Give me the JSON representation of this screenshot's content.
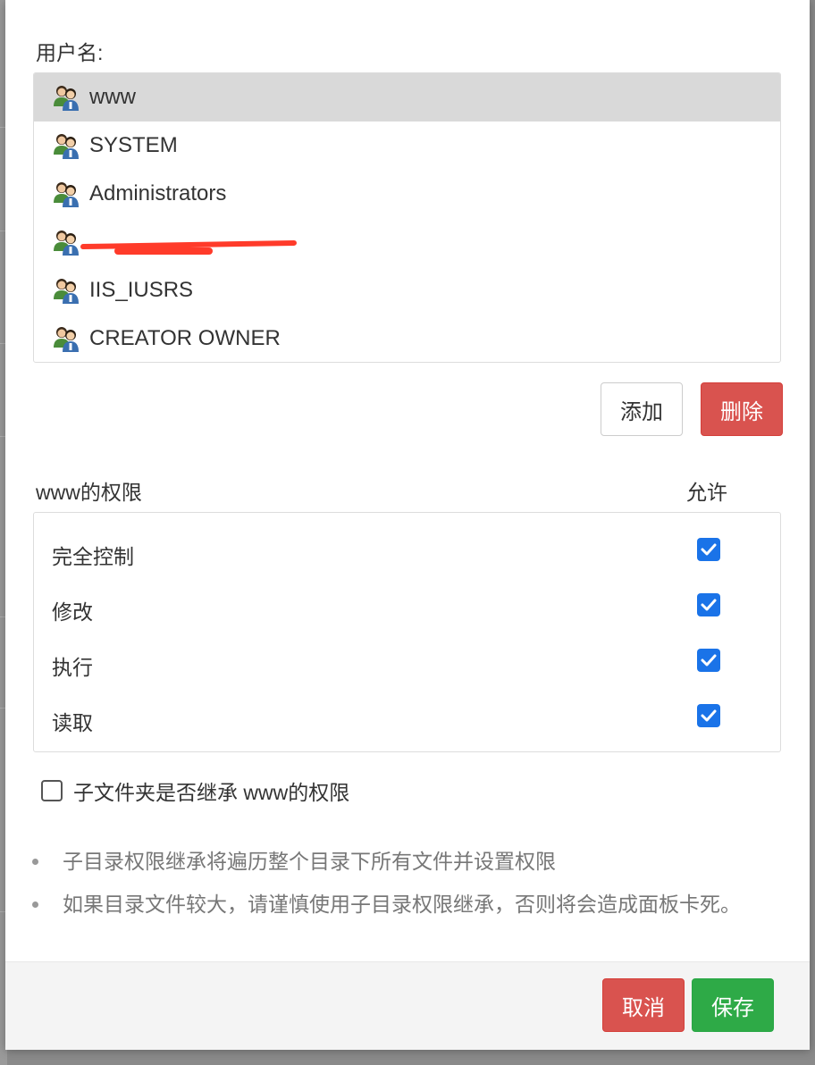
{
  "dialog": {
    "username_label": "用户名:",
    "users": [
      {
        "name": "www",
        "selected": true
      },
      {
        "name": "SYSTEM",
        "selected": false
      },
      {
        "name": "Administrators",
        "selected": false
      },
      {
        "name": "",
        "selected": false,
        "redacted": true
      },
      {
        "name": "IIS_IUSRS",
        "selected": false
      },
      {
        "name": "CREATOR OWNER",
        "selected": false
      }
    ],
    "add_label": "添加",
    "delete_label": "删除",
    "permissions_title": "www的权限",
    "allow_header": "允许",
    "permissions": [
      {
        "label": "完全控制",
        "allowed": true
      },
      {
        "label": "修改",
        "allowed": true
      },
      {
        "label": "执行",
        "allowed": true
      },
      {
        "label": "读取",
        "allowed": true
      }
    ],
    "inherit_label": "子文件夹是否继承 www的权限",
    "inherit_checked": false,
    "notes": [
      "子目录权限继承将遍历整个目录下所有文件并设置权限",
      "如果目录文件较大，请谨慎使用子目录权限继承，否则将会造成面板卡死。"
    ],
    "cancel_label": "取消",
    "save_label": "保存"
  },
  "colors": {
    "selected_row": "#d9d9d9",
    "danger": "#d9534f",
    "success": "#2eaa47",
    "checkbox": "#1a73e8",
    "redaction": "#ff3b2a"
  },
  "icons": {
    "user": "user-group-icon",
    "check": "check-icon"
  }
}
